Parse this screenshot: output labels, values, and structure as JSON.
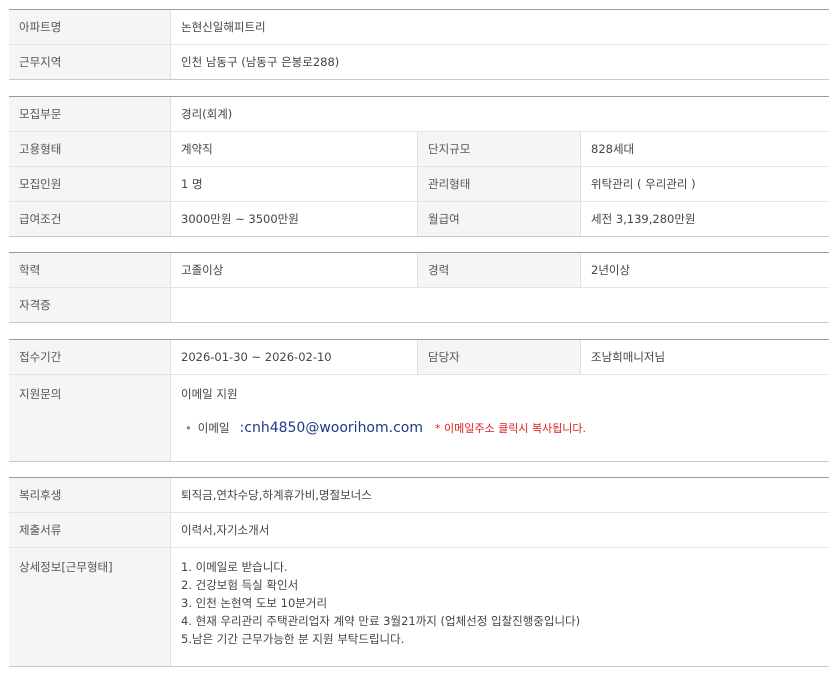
{
  "section1": {
    "apartment_label": "아파트명",
    "apartment_value": "논현신일해피트리",
    "area_label": "근무지역",
    "area_value": "인천  남동구 (남동구 은봉로288)"
  },
  "section2": {
    "category_label": "모집부문",
    "category_value": "경리(회계)",
    "employment_label": "고용형태",
    "employment_value": "계약직",
    "scale_label": "단지규모",
    "scale_value": "828세대",
    "headcount_label": "모집인원",
    "headcount_value": "1 명",
    "mgmt_label": "관리형태",
    "mgmt_value": "위탁관리 ( 우리관리 )",
    "salary_label": "급여조건",
    "salary_value": "3000만원 ~ 3500만원",
    "monthly_label": "월급여",
    "monthly_value": "세전 3,139,280만원"
  },
  "section3": {
    "education_label": "학력",
    "education_value": "고졸이상",
    "experience_label": "경력",
    "experience_value": "2년이상",
    "license_label": "자격증",
    "license_value": ""
  },
  "section4": {
    "period_label": "접수기간",
    "period_value": "2026-01-30 ~ 2026-02-10",
    "manager_label": "담당자",
    "manager_value": "조남희매니저님",
    "inquiry_label": "지원문의",
    "inquiry_method": "이메일 지원",
    "email_label": "이메일",
    "email_value": ":cnh4850@woorihom.com",
    "email_note": "* 이메일주소 클릭시 복사됩니다."
  },
  "section5": {
    "welfare_label": "복리후생",
    "welfare_value": "퇴직금,연차수당,하계휴가비,명절보너스",
    "documents_label": "제출서류",
    "documents_value": "이력서,자기소개서",
    "detail_label": "상세정보[근무형태]",
    "detail_lines": [
      "1. 이메일로 받습니다.",
      "2. 건강보험 득실 확인서",
      "3. 인천 논현역 도보 10분거리",
      "4. 현재 우리관리 주택관리업자 계약 만료 3월21까지 (업체선정 입찰진행중입니다)",
      "5.남은 기간 근무가능한 분 지원 부탁드립니다."
    ]
  }
}
